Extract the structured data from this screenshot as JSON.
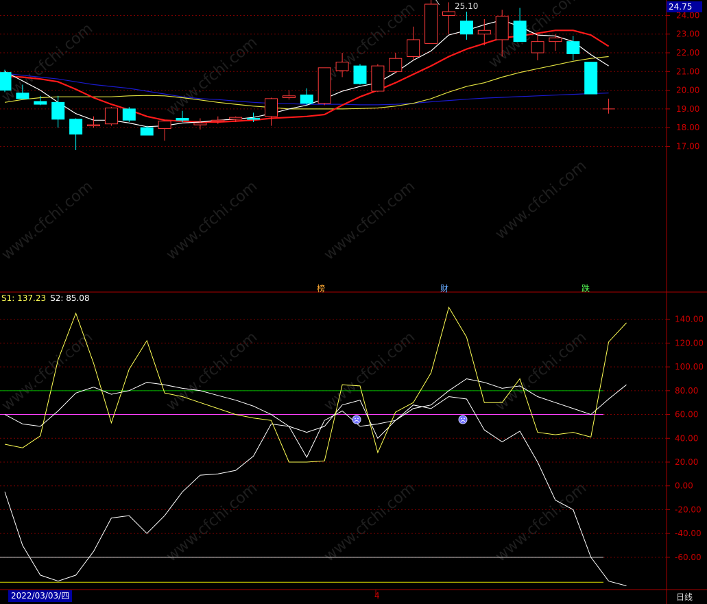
{
  "price_axis": {
    "labels": [
      "24.00",
      "23.00",
      "22.00",
      "21.00",
      "20.00",
      "19.00",
      "18.00",
      "17.00"
    ],
    "last_price": "24.75"
  },
  "indicator_axis": {
    "labels": [
      "140.00",
      "120.00",
      "100.00",
      "80.00",
      "60.00",
      "40.00",
      "20.00",
      "0.00",
      "-20.00",
      "-40.00",
      "-60.00"
    ]
  },
  "legend": {
    "s1": "S1: 137.23",
    "s2": "S2: 85.08"
  },
  "peak_label": "25.10",
  "events": [
    "榜",
    "财",
    "跌"
  ],
  "footer": {
    "date": "2022/03/03/四",
    "month_marker": "4",
    "period": "日线"
  },
  "watermark": "www.cfchi.com",
  "colors": {
    "up": "#ff3b3b",
    "down": "#00ffff",
    "ma_white": "#ffffff",
    "ma_red": "#ff1a1a",
    "ma_yellow": "#e0e040",
    "ma_blue": "#1a1acc",
    "ref_green": "#00c000",
    "ref_magenta": "#ff40ff",
    "s1_color": "#ffff55",
    "s2_color": "#ffffff"
  },
  "chart_data": {
    "type": "candlestick",
    "candles": [
      {
        "o": 20.95,
        "h": 21.1,
        "l": 19.9,
        "c": 20.0
      },
      {
        "o": 19.85,
        "h": 20.3,
        "l": 19.6,
        "c": 19.55
      },
      {
        "o": 19.4,
        "h": 19.7,
        "l": 19.2,
        "c": 19.25
      },
      {
        "o": 19.35,
        "h": 19.7,
        "l": 18.0,
        "c": 18.45
      },
      {
        "o": 18.45,
        "h": 18.5,
        "l": 16.8,
        "c": 17.65
      },
      {
        "o": 18.1,
        "h": 18.6,
        "l": 18.0,
        "c": 18.15
      },
      {
        "o": 18.2,
        "h": 19.1,
        "l": 18.1,
        "c": 19.05
      },
      {
        "o": 19.0,
        "h": 19.1,
        "l": 18.3,
        "c": 18.4
      },
      {
        "o": 18.0,
        "h": 18.1,
        "l": 17.6,
        "c": 17.6
      },
      {
        "o": 17.95,
        "h": 18.4,
        "l": 17.3,
        "c": 18.35
      },
      {
        "o": 18.5,
        "h": 18.9,
        "l": 18.3,
        "c": 18.4
      },
      {
        "o": 18.15,
        "h": 18.5,
        "l": 17.9,
        "c": 18.25
      },
      {
        "o": 18.35,
        "h": 18.6,
        "l": 18.2,
        "c": 18.4
      },
      {
        "o": 18.45,
        "h": 18.6,
        "l": 18.3,
        "c": 18.55
      },
      {
        "o": 18.5,
        "h": 18.8,
        "l": 18.3,
        "c": 18.45
      },
      {
        "o": 18.6,
        "h": 19.6,
        "l": 18.1,
        "c": 19.55
      },
      {
        "o": 19.6,
        "h": 20.0,
        "l": 19.5,
        "c": 19.7
      },
      {
        "o": 19.75,
        "h": 20.1,
        "l": 19.2,
        "c": 19.3
      },
      {
        "o": 19.3,
        "h": 21.2,
        "l": 19.2,
        "c": 21.2
      },
      {
        "o": 21.05,
        "h": 22.0,
        "l": 20.7,
        "c": 21.5
      },
      {
        "o": 21.3,
        "h": 21.4,
        "l": 20.3,
        "c": 20.35
      },
      {
        "o": 19.95,
        "h": 21.4,
        "l": 19.9,
        "c": 21.3
      },
      {
        "o": 21.0,
        "h": 22.0,
        "l": 20.9,
        "c": 21.7
      },
      {
        "o": 21.8,
        "h": 23.4,
        "l": 21.6,
        "c": 22.7
      },
      {
        "o": 22.5,
        "h": 25.1,
        "l": 22.5,
        "c": 24.6
      },
      {
        "o": 24.0,
        "h": 24.7,
        "l": 23.0,
        "c": 24.2
      },
      {
        "o": 23.7,
        "h": 24.2,
        "l": 22.7,
        "c": 23.0
      },
      {
        "o": 23.0,
        "h": 23.8,
        "l": 22.4,
        "c": 23.2
      },
      {
        "o": 22.7,
        "h": 24.3,
        "l": 21.8,
        "c": 23.95
      },
      {
        "o": 23.7,
        "h": 24.4,
        "l": 22.6,
        "c": 22.6
      },
      {
        "o": 22.0,
        "h": 23.0,
        "l": 21.6,
        "c": 22.6
      },
      {
        "o": 22.6,
        "h": 23.0,
        "l": 22.1,
        "c": 22.8
      },
      {
        "o": 22.6,
        "h": 22.9,
        "l": 21.6,
        "c": 21.95
      },
      {
        "o": 21.5,
        "h": 21.5,
        "l": 19.8,
        "c": 19.8
      },
      {
        "o": 19.0,
        "h": 19.55,
        "l": 18.75,
        "c": 19.0
      }
    ],
    "ma_white": [
      21.0,
      20.5,
      20.0,
      19.35,
      18.75,
      18.4,
      18.4,
      18.25,
      18.05,
      18.1,
      18.25,
      18.3,
      18.4,
      18.45,
      18.55,
      18.75,
      19.0,
      19.2,
      19.55,
      19.95,
      20.2,
      20.4,
      20.95,
      21.6,
      22.1,
      22.95,
      23.2,
      23.5,
      23.75,
      23.4,
      22.95,
      22.9,
      22.6,
      21.9,
      21.3
    ],
    "ma_red": [
      20.75,
      20.7,
      20.6,
      20.45,
      20.05,
      19.6,
      19.25,
      18.95,
      18.6,
      18.4,
      18.35,
      18.3,
      18.3,
      18.35,
      18.4,
      18.5,
      18.55,
      18.6,
      18.7,
      19.2,
      19.65,
      20.0,
      20.4,
      20.85,
      21.3,
      21.8,
      22.2,
      22.5,
      22.8,
      22.9,
      23.05,
      23.2,
      23.2,
      22.95,
      22.35
    ],
    "ma_yellow": [
      19.35,
      19.5,
      19.6,
      19.65,
      19.65,
      19.65,
      19.65,
      19.7,
      19.72,
      19.7,
      19.6,
      19.48,
      19.35,
      19.25,
      19.15,
      19.08,
      19.0,
      19.0,
      19.0,
      19.0,
      19.02,
      19.05,
      19.15,
      19.3,
      19.55,
      19.9,
      20.2,
      20.4,
      20.7,
      20.95,
      21.15,
      21.35,
      21.55,
      21.7,
      21.8
    ],
    "ma_blue": [
      20.9,
      20.8,
      20.7,
      20.6,
      20.45,
      20.3,
      20.2,
      20.1,
      19.95,
      19.8,
      19.65,
      19.55,
      19.5,
      19.42,
      19.35,
      19.3,
      19.28,
      19.25,
      19.25,
      19.25,
      19.22,
      19.22,
      19.25,
      19.3,
      19.38,
      19.45,
      19.52,
      19.58,
      19.62,
      19.66,
      19.7,
      19.74,
      19.78,
      19.82,
      19.85
    ],
    "indicator": {
      "s1": [
        35,
        32,
        42,
        106,
        145,
        103,
        53,
        98,
        122,
        78,
        75,
        70,
        65,
        60,
        57,
        55,
        20,
        20,
        21,
        85,
        84,
        28,
        62,
        70,
        95,
        150,
        125,
        70,
        70,
        90,
        45,
        43,
        45,
        41,
        121,
        137
      ],
      "s2": [
        60,
        52,
        50,
        63,
        78,
        83,
        77,
        80,
        87,
        85,
        82,
        80,
        76,
        72,
        67,
        60,
        50,
        45,
        50,
        68,
        72,
        40,
        55,
        65,
        68,
        80,
        90,
        87,
        82,
        84,
        75,
        70,
        65,
        60,
        73,
        85
      ],
      "s3": [
        -5,
        -50,
        -75,
        -80,
        -75,
        -55,
        -27,
        -25,
        -40,
        -25,
        -5,
        9,
        10,
        13,
        25,
        52,
        50,
        24,
        55,
        63,
        50,
        52,
        55,
        68,
        65,
        75,
        73,
        47,
        37,
        46,
        20,
        -12,
        -20,
        -60,
        -80,
        -84
      ],
      "green_line": 80,
      "magenta_line": 60,
      "white_line": -60,
      "yellow_line": -81,
      "ylim": [
        -81,
        150
      ]
    },
    "price_ylim": [
      16.5,
      25.2
    ]
  }
}
